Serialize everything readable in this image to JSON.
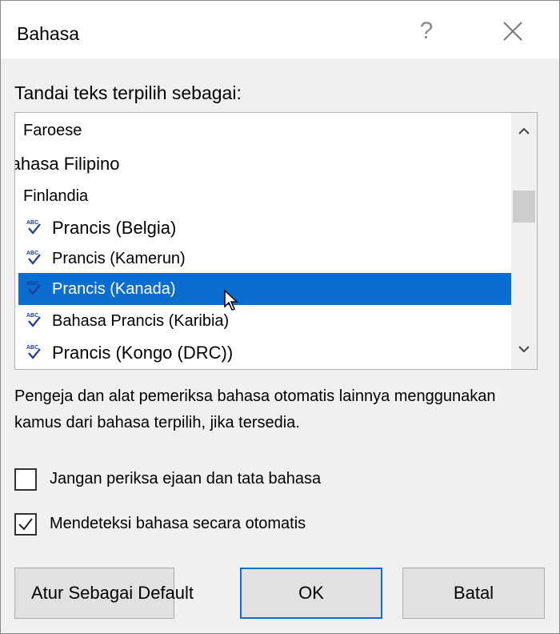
{
  "dialog": {
    "title": "Bahasa",
    "help_glyph": "?",
    "close_icon": "close-icon"
  },
  "prompt": "Tandai teks terpilih sebagai:",
  "languages": [
    {
      "label": "Faroese",
      "spell_icon": false,
      "selected": false
    },
    {
      "label": "Bahasa Filipino",
      "spell_icon": false,
      "selected": false
    },
    {
      "label": "Finlandia",
      "spell_icon": false,
      "selected": false
    },
    {
      "label": "Prancis (Belgia)",
      "spell_icon": true,
      "selected": false
    },
    {
      "label": "Prancis (Kamerun)",
      "spell_icon": true,
      "selected": false
    },
    {
      "label": "Prancis (Kanada)",
      "spell_icon": true,
      "selected": true
    },
    {
      "label": "Bahasa Prancis (Karibia)",
      "spell_icon": true,
      "selected": false
    },
    {
      "label": "Prancis (Kongo (DRC))",
      "spell_icon": true,
      "selected": false
    }
  ],
  "info_text": "Pengeja dan alat pemeriksa bahasa otomatis lainnya menggunakan kamus dari bahasa terpilih, jika tersedia.",
  "options": {
    "no_proofing": {
      "label": "Jangan periksa ejaan dan tata bahasa",
      "checked": false
    },
    "auto_detect": {
      "label": "Mendeteksi bahasa secara otomatis",
      "checked": true
    }
  },
  "buttons": {
    "set_default": "Atur Sebagai Default",
    "ok": "OK",
    "cancel": "Batal"
  },
  "colors": {
    "selection": "#0a6ed1",
    "spell_icon": "#1f3d99"
  }
}
